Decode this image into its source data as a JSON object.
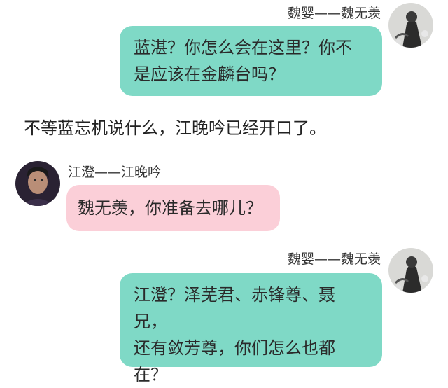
{
  "messages": [
    {
      "sender": "魏婴——魏无羡",
      "lines": [
        "蓝湛？你怎么会在这里？你不",
        "是应该在金麟台吗？"
      ]
    },
    {
      "narration": "不等蓝忘机说什么，江晚吟已经开口了。"
    },
    {
      "sender": "江澄——江晚吟",
      "lines": [
        "魏无羡，你准备去哪儿？"
      ]
    },
    {
      "sender": "魏婴——魏无羡",
      "lines": [
        "江澄？泽芜君、赤锋尊、聂兄，",
        "还有敛芳尊，你们怎么也都",
        "在？"
      ]
    }
  ],
  "colors": {
    "teal_bubble": "#7fd9c6",
    "pink_bubble": "#fbcfd8"
  },
  "icons": {
    "wei_avatar": "avatar-wei-ying",
    "jiang_avatar": "avatar-jiang-cheng"
  }
}
